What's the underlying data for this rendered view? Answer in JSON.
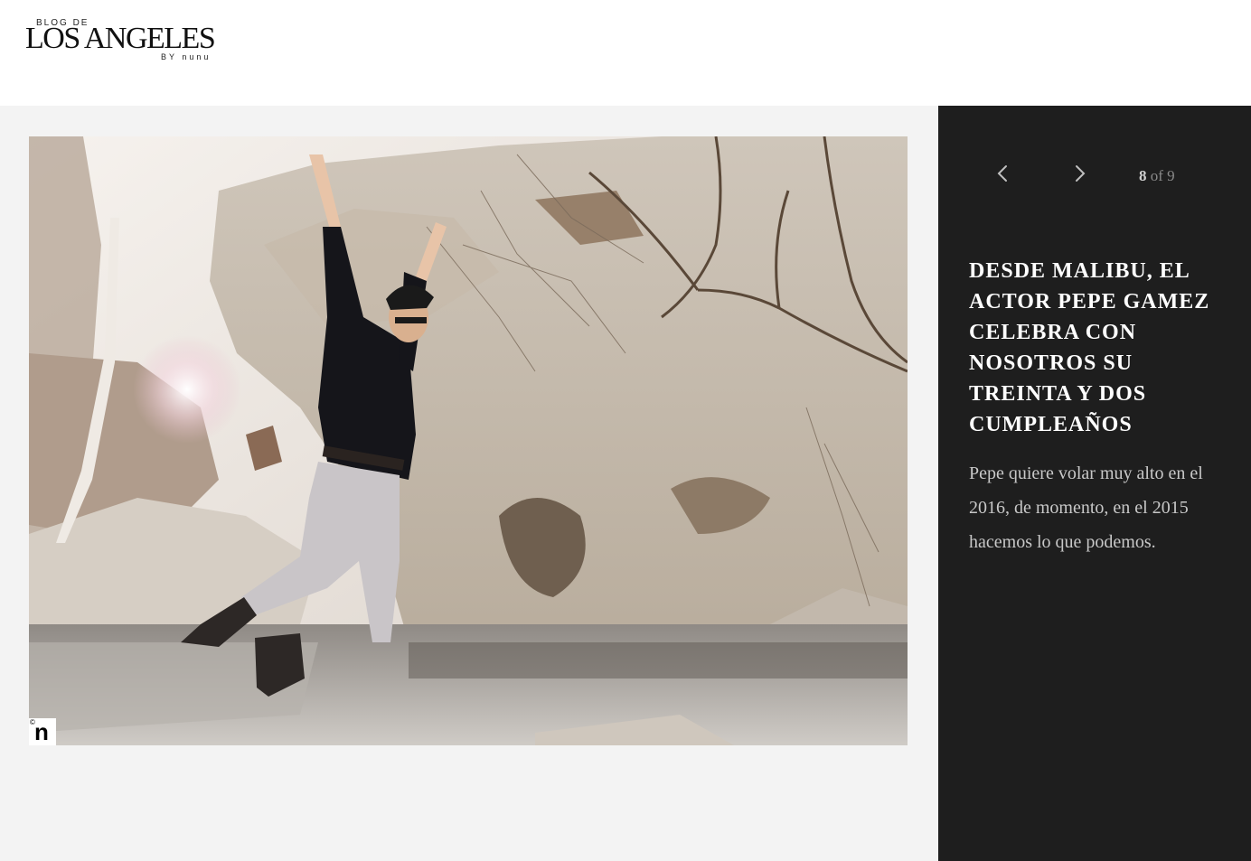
{
  "header": {
    "logo": {
      "top": "BLOG DE",
      "main": "LOS ANGELES",
      "by": "BY nunu"
    }
  },
  "gallery": {
    "photo_alt": "Pepe Gamez jumping across a creek among rocks in Malibu",
    "watermark_copyright": "©",
    "watermark_letter": "n"
  },
  "panel": {
    "nav": {
      "prev_icon": "chevron-left-icon",
      "next_icon": "chevron-right-icon",
      "current": "8",
      "of_text": "of 9"
    },
    "title": "DESDE MALIBU, EL ACTOR PEPE GAMEZ CELEBRA CON NOSOTROS SU TREINTA Y DOS CUMPLEAÑOS",
    "description": "Pepe quiere volar muy alto en el 2016, de momento, en el 2015 hacemos lo que podemos."
  },
  "colors": {
    "panel_bg": "#1e1e1e",
    "stage_bg": "#f3f3f3",
    "title_text": "#ffffff",
    "body_text": "#c8c8c8",
    "muted_text": "#8a8a8a"
  }
}
